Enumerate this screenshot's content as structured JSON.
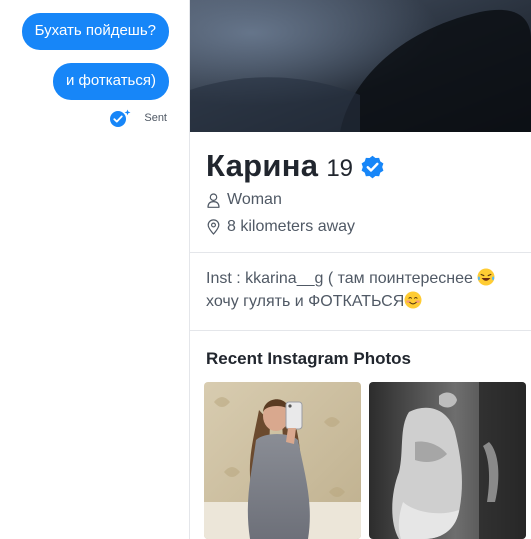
{
  "chat": {
    "messages": [
      {
        "text": "Бухать пойдешь?"
      },
      {
        "text": "и фоткаться)"
      }
    ],
    "status_label": "Sent",
    "accent_color": "#1786f8"
  },
  "profile": {
    "name": "Карина",
    "age": "19",
    "verified_icon": "verified-badge-icon",
    "gender": "Woman",
    "distance": "8 kilometers away",
    "bio_line1": "Inst : kkarina__g ( там поинтереснее",
    "bio_line2": "хочу гулять и ФОТКАТЬСЯ",
    "bio_emojis": [
      "laughing-tears-emoji",
      "smiling-blush-emoji"
    ],
    "photos_title": "Recent Instagram Photos",
    "photos": [
      {
        "icon": "instagram-photo-mirror-selfie"
      },
      {
        "icon": "instagram-photo-black-and-white"
      }
    ]
  }
}
